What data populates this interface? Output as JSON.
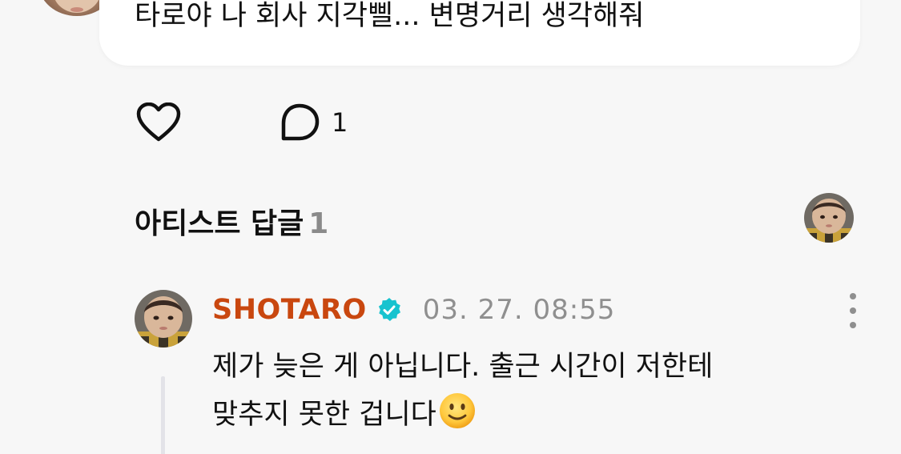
{
  "post": {
    "text": "타로야 나 회사 지각삘... 변명거리 생각해줘"
  },
  "actions": {
    "like_icon": "heart-outline-icon",
    "comment_icon": "speech-bubble-icon",
    "comment_count": "1"
  },
  "artist_replies": {
    "title": "아티스트 답글",
    "count": "1"
  },
  "reply": {
    "author": "SHOTARO",
    "verified_icon": "verified-badge-icon",
    "timestamp": "03. 27. 08:55",
    "line1": "제가 늦은 게 아닙니다. 출근 시간이 저한테",
    "line2": "맞추지 못한 겁니다",
    "emoji": "slightly-smiling-face-icon"
  },
  "colors": {
    "background": "#f7f7f7",
    "card": "#ffffff",
    "author": "#c9470f",
    "verified": "#17c3cf",
    "muted": "#8f8f8f"
  }
}
